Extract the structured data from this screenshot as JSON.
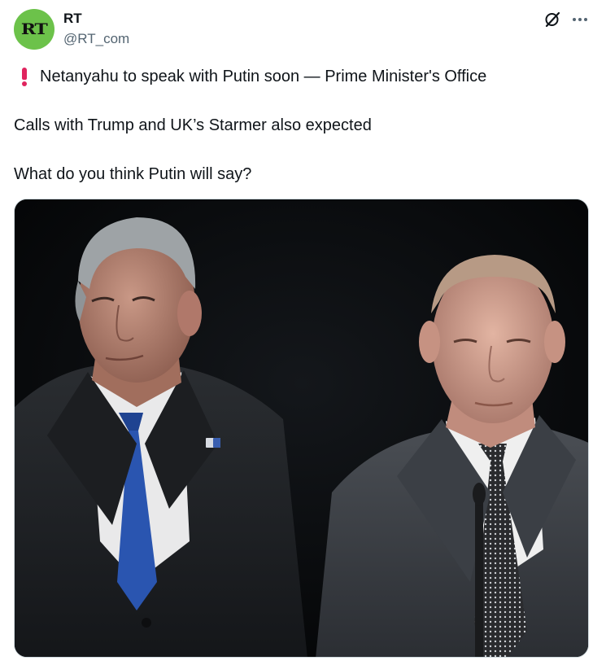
{
  "author": {
    "avatar_text": "RT",
    "display_name": "RT",
    "handle": "@RT_com",
    "avatar_color": "#6cc24a"
  },
  "actions": {
    "grok_icon": "grok-icon",
    "more_icon": "more-icon"
  },
  "tweet": {
    "line1_icon": "red-exclamation-icon",
    "line1": "Netanyahu to speak with Putin soon — Prime Minister's Office",
    "line2": "Calls with Trump and UK’s Starmer also expected",
    "line3": "What do you think Putin will say?"
  },
  "media": {
    "type": "photo",
    "subject": "photo of Netanyahu (left) and Putin (right) against a dark background"
  },
  "colors": {
    "text": "#0f1419",
    "secondary_text": "#536471",
    "accent_red": "#e0245e"
  }
}
